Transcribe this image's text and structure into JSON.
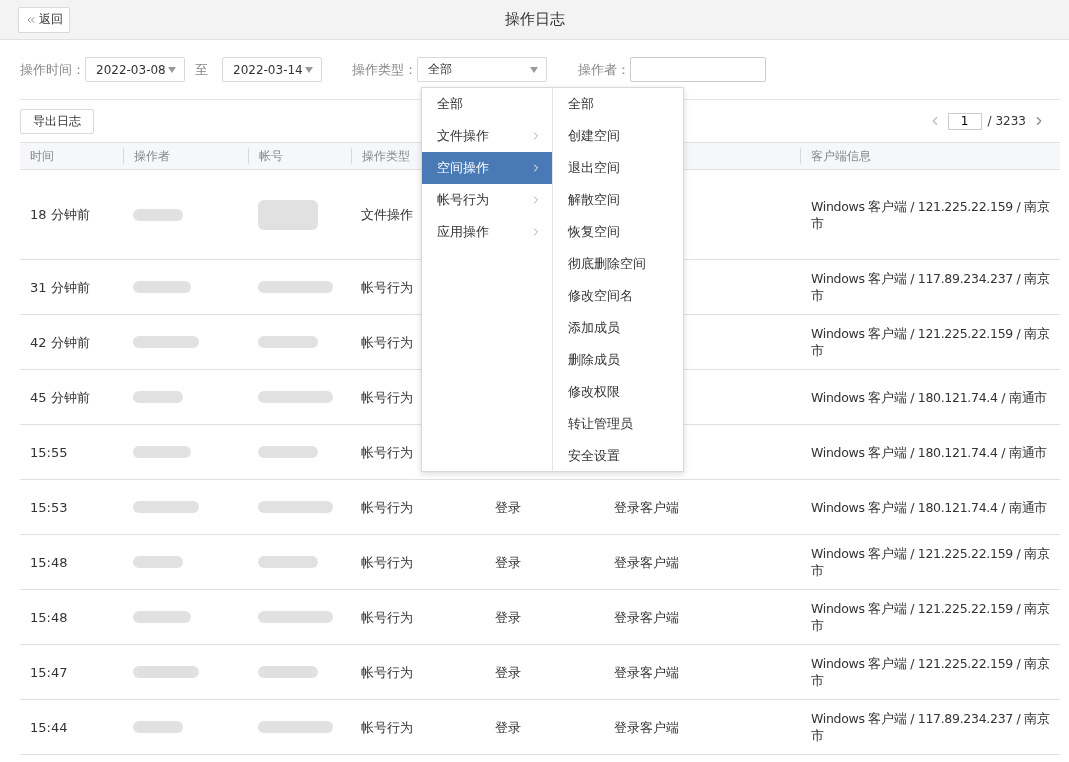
{
  "header": {
    "back_label": "返回",
    "title": "操作日志"
  },
  "filters": {
    "time_label": "操作时间：",
    "date_from": "2022-03-08",
    "date_separator": "至",
    "date_to": "2022-03-14",
    "type_label": "操作类型：",
    "type_value": "全部",
    "operator_label": "操作者："
  },
  "export_button": "导出日志",
  "pagination": {
    "page": "1",
    "total": "/ 3233"
  },
  "table": {
    "columns": [
      "时间",
      "操作者",
      "帐号",
      "操作类型",
      "客户端信息"
    ],
    "rows": [
      {
        "time": "18 分钟前",
        "type": "文件操作",
        "client": "Windows 客户端 / 121.225.22.159 / 南京市"
      },
      {
        "time": "31 分钟前",
        "type": "帐号行为",
        "client": "Windows 客户端 / 117.89.234.237 / 南京市"
      },
      {
        "time": "42 分钟前",
        "type": "帐号行为",
        "client": "Windows 客户端 / 121.225.22.159 / 南京市"
      },
      {
        "time": "45 分钟前",
        "type": "帐号行为",
        "client": "Windows 客户端 / 180.121.74.4 / 南通市"
      },
      {
        "time": "15:55",
        "type": "帐号行为",
        "client": "Windows 客户端 / 180.121.74.4 / 南通市"
      },
      {
        "time": "15:53",
        "type": "帐号行为",
        "action": "登录",
        "detail": "登录客户端",
        "client": "Windows 客户端 / 180.121.74.4 / 南通市"
      },
      {
        "time": "15:48",
        "type": "帐号行为",
        "action": "登录",
        "detail": "登录客户端",
        "client": "Windows 客户端 / 121.225.22.159 / 南京市"
      },
      {
        "time": "15:48",
        "type": "帐号行为",
        "action": "登录",
        "detail": "登录客户端",
        "client": "Windows 客户端 / 121.225.22.159 / 南京市"
      },
      {
        "time": "15:47",
        "type": "帐号行为",
        "action": "登录",
        "detail": "登录客户端",
        "client": "Windows 客户端 / 121.225.22.159 / 南京市"
      },
      {
        "time": "15:44",
        "type": "帐号行为",
        "action": "登录",
        "detail": "登录客户端",
        "client": "Windows 客户端 / 117.89.234.237 / 南京市"
      }
    ]
  },
  "type_menu": {
    "categories": [
      {
        "label": "全部",
        "has_submenu": false,
        "selected": false
      },
      {
        "label": "文件操作",
        "has_submenu": true,
        "selected": false
      },
      {
        "label": "空间操作",
        "has_submenu": true,
        "selected": true
      },
      {
        "label": "帐号行为",
        "has_submenu": true,
        "selected": false
      },
      {
        "label": "应用操作",
        "has_submenu": true,
        "selected": false
      }
    ],
    "subitems": [
      "全部",
      "创建空间",
      "退出空间",
      "解散空间",
      "恢复空间",
      "彻底删除空间",
      "修改空间名",
      "添加成员",
      "删除成员",
      "修改权限",
      "转让管理员",
      "安全设置"
    ]
  }
}
